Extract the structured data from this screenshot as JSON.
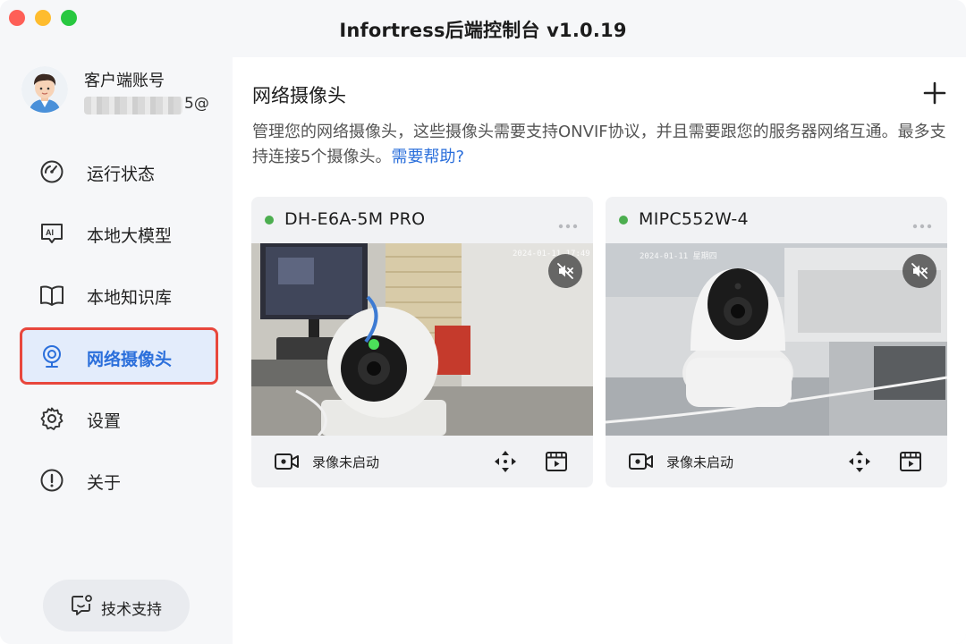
{
  "window": {
    "title": "Infortress后端控制台 v1.0.19"
  },
  "account": {
    "label": "客户端账号",
    "email_visible_suffix": "5@"
  },
  "sidebar": {
    "items": [
      {
        "label": "运行状态",
        "icon": "gauge-icon",
        "active": false
      },
      {
        "label": "本地大模型",
        "icon": "ai-icon",
        "active": false
      },
      {
        "label": "本地知识库",
        "icon": "book-icon",
        "active": false
      },
      {
        "label": "网络摄像头",
        "icon": "webcam-icon",
        "active": true
      },
      {
        "label": "设置",
        "icon": "gear-icon",
        "active": false
      },
      {
        "label": "关于",
        "icon": "info-icon",
        "active": false
      }
    ],
    "support_label": "技术支持"
  },
  "main": {
    "title": "网络摄像头",
    "description": "管理您的网络摄像头，这些摄像头需要支持ONVIF协议，并且需要跟您的服务器网络互通。最多支持连接5个摄像头。",
    "help_link": "需要帮助?",
    "cameras": [
      {
        "name": "DH-E6A-5M PRO",
        "status": "online",
        "record_status": "录像未启动",
        "osd_time": "2024-01-11 17:49"
      },
      {
        "name": "MIPC552W-4",
        "status": "online",
        "record_status": "录像未启动",
        "osd_time": "2024-01-11 星期四"
      }
    ]
  },
  "colors": {
    "accent": "#2b6fdb",
    "online": "#4cae4f",
    "highlight_border": "#e8473d"
  }
}
